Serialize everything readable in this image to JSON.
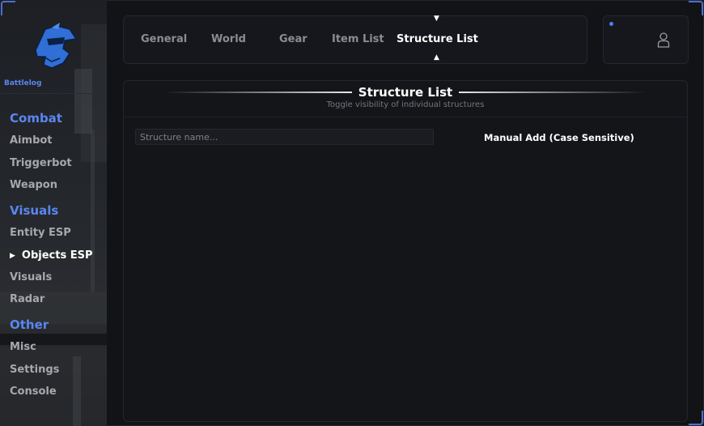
{
  "app": {
    "brand": "Battlelog",
    "accent_color": "#5b86f0"
  },
  "sidebar": {
    "sections": [
      {
        "title": "Combat",
        "items": [
          "Aimbot",
          "Triggerbot",
          "Weapon"
        ]
      },
      {
        "title": "Visuals",
        "items": [
          "Entity ESP",
          "Objects ESP",
          "Visuals",
          "Radar"
        ]
      },
      {
        "title": "Other",
        "items": [
          "Misc",
          "Settings",
          "Console"
        ]
      }
    ],
    "active_item": "Objects ESP",
    "active_arrow": "▶"
  },
  "tabs": {
    "items": [
      "General",
      "World",
      "Gear",
      "Item List",
      "Structure List"
    ],
    "active": "Structure List",
    "indicator_down": "▼",
    "indicator_up": "▲"
  },
  "profile": {
    "icon": "user-icon",
    "status_color": "#4f7df3"
  },
  "panel": {
    "title": "Structure List",
    "subtitle": "Toggle visibility of individual structures",
    "search_placeholder": "Structure name...",
    "search_value": "",
    "add_button_label": "Manual Add (Case Sensitive)"
  }
}
